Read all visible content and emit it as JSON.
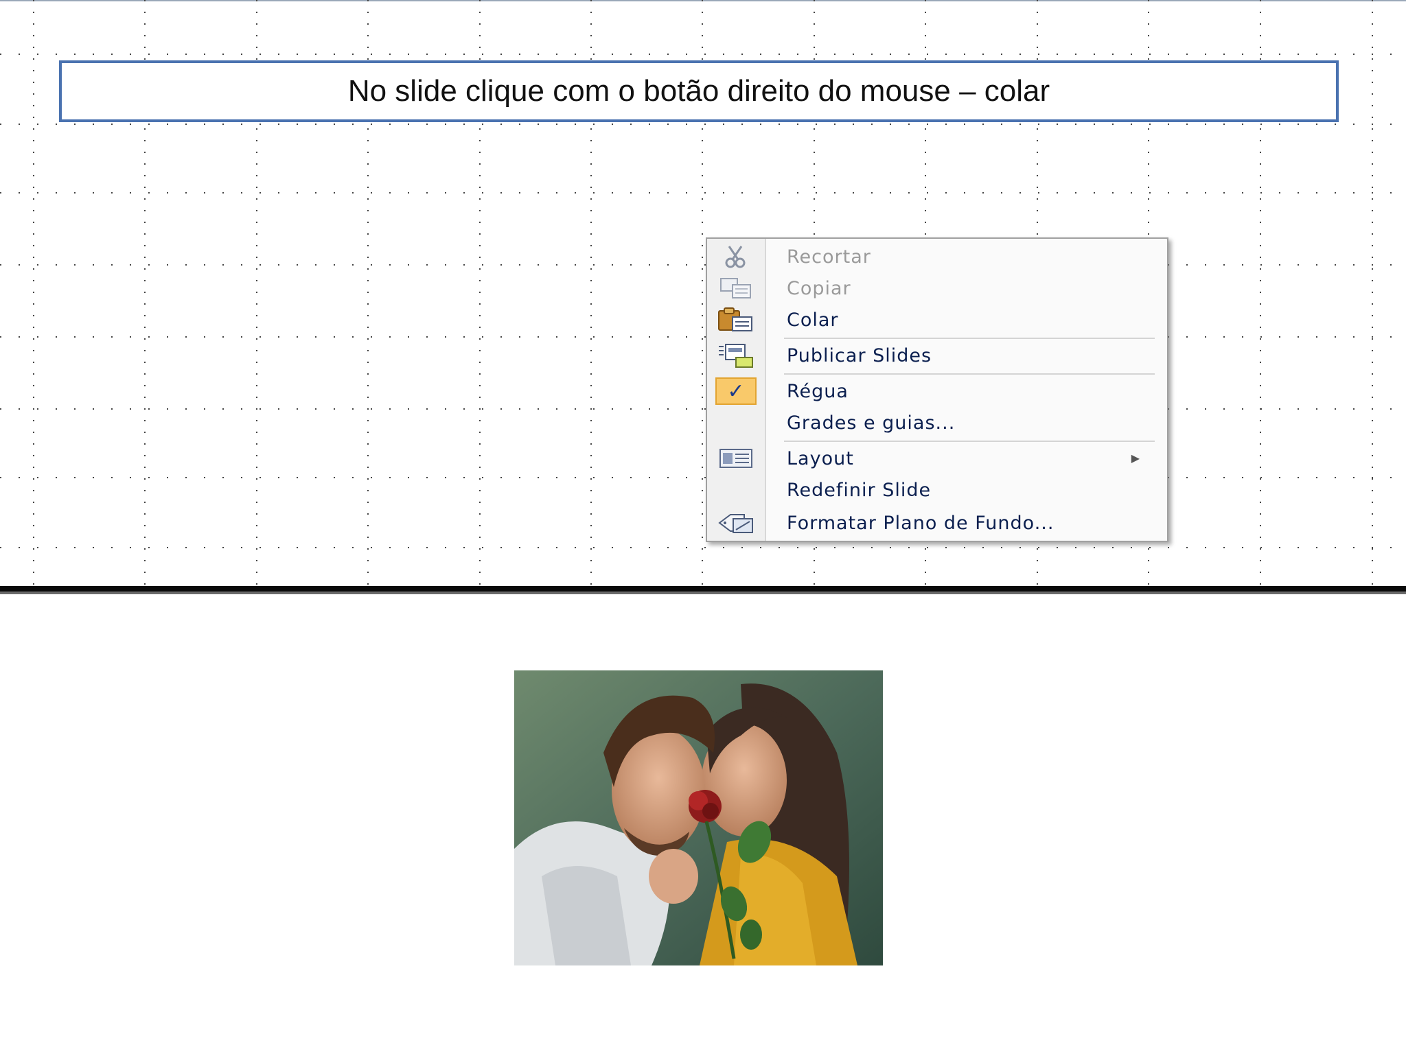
{
  "slide": {
    "title": "No slide clique com o botão direito do mouse – colar"
  },
  "context_menu": {
    "items": [
      {
        "label": "Recortar",
        "icon": "scissors-icon",
        "enabled": false
      },
      {
        "label": "Copiar",
        "icon": "copy-icon",
        "enabled": false
      },
      {
        "label": "Colar",
        "icon": "paste-icon",
        "enabled": true
      },
      {
        "label": "Publicar Slides",
        "icon": "publish-slides-icon",
        "enabled": true
      },
      {
        "label": "Régua",
        "icon": "checkmark-icon",
        "enabled": true,
        "checked": true
      },
      {
        "label": "Grades e guias...",
        "icon": "",
        "enabled": true
      },
      {
        "label": "Layout",
        "icon": "layout-icon",
        "enabled": true,
        "submenu": true
      },
      {
        "label": "Redefinir Slide",
        "icon": "",
        "enabled": true
      },
      {
        "label": "Formatar Plano de Fundo...",
        "icon": "format-background-icon",
        "enabled": true
      }
    ],
    "submenu_arrow": "▶",
    "check_mark": "✓"
  },
  "colors": {
    "title_border": "#4a72b0",
    "menu_text": "#0b1f4f",
    "disabled_text": "#9a9a9a",
    "check_highlight": "#f9c96a"
  }
}
